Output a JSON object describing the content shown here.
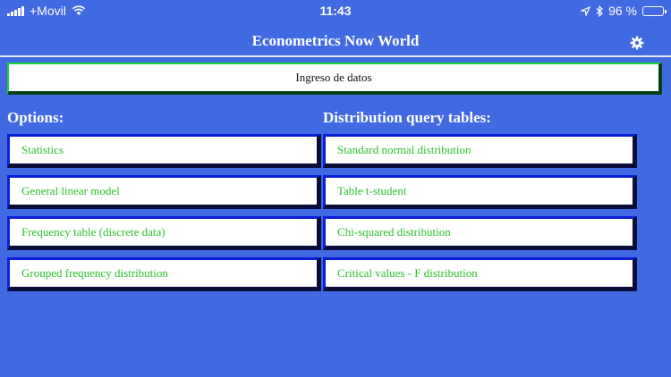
{
  "status_bar": {
    "carrier": "+Movil",
    "time": "11:43",
    "battery_text": "96 %",
    "battery_level": 0.96
  },
  "header": {
    "title": "Econometrics Now World",
    "settings_icon": "gear-icon"
  },
  "data_entry_label": "Ingreso de datos",
  "options": {
    "heading": "Options:",
    "items": [
      "Statistics",
      "General linear model",
      "Frequency table (discrete data)",
      "Grouped frequency distribution"
    ]
  },
  "tables": {
    "heading": "Distribution query tables:",
    "items": [
      "Standard normal distribution",
      "Table t-student",
      "Chi-squared distribution",
      "Critical values - F distribution"
    ]
  },
  "colors": {
    "background": "#4169e1",
    "button_text": "#2bbf2b",
    "button_border": "#0a1fd6",
    "entry_border": "#19d63a"
  }
}
